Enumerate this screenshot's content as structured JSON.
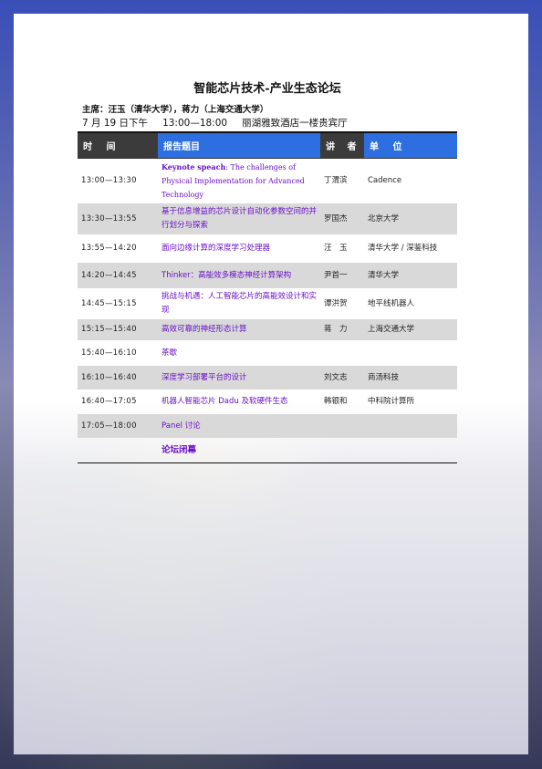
{
  "title": "智能芯片技术-产业生态论坛",
  "chair": "主席：汪玉（清华大学），蒋力（上海交通大学）",
  "session": {
    "date": "7 月 19 日下午",
    "time": "13:00—18:00",
    "venue": "丽湖雅致酒店一楼贵宾厅"
  },
  "headers": {
    "time": "时 间",
    "topic": "报告题目",
    "speaker": "讲 者",
    "unit": "单 位"
  },
  "rows": [
    {
      "time": "13:00—13:30",
      "topic_bold": "Keynote speach",
      "topic": ": The challenges of Physical Implementation for Advanced Technology",
      "speaker": "丁渭滨",
      "unit": "Cadence"
    },
    {
      "time": "13:30—13:55",
      "topic": "基于信息增益的芯片设计自动化参数空间的并行划分与探索",
      "speaker": "罗国杰",
      "unit": "北京大学"
    },
    {
      "time": "13:55—14:20",
      "topic": "面向边缘计算的深度学习处理器",
      "speaker": "汪　玉",
      "unit": "清华大学 / 深鉴科技"
    },
    {
      "time": "14:20—14:45",
      "topic": "Thinker：高能效多模态神经计算架构",
      "speaker": "尹首一",
      "unit": "清华大学"
    },
    {
      "time": "14:45—15:15",
      "topic": "挑战与机遇：人工智能芯片的高能效设计和实现",
      "speaker": "谭洪贺",
      "unit": "地平线机器人"
    },
    {
      "time": "15:15—15:40",
      "topic": "高效可靠的神经形态计算",
      "speaker": "蒋　力",
      "unit": "上海交通大学"
    },
    {
      "time": "15:40—16:10",
      "topic": "茶歇",
      "speaker": "",
      "unit": ""
    },
    {
      "time": "16:10—16:40",
      "topic": "深度学习部署平台的设计",
      "speaker": "刘文志",
      "unit": "商汤科技"
    },
    {
      "time": "16:40—17:05",
      "topic": "机器人智能芯片 Dadu 及软硬件生态",
      "speaker": "韩银和",
      "unit": "中科院计算所"
    },
    {
      "time": "17:05—18:00",
      "topic": "Panel 讨论",
      "speaker": "",
      "unit": ""
    },
    {
      "time": "",
      "topic": "论坛闭幕",
      "speaker": "",
      "unit": ""
    }
  ]
}
